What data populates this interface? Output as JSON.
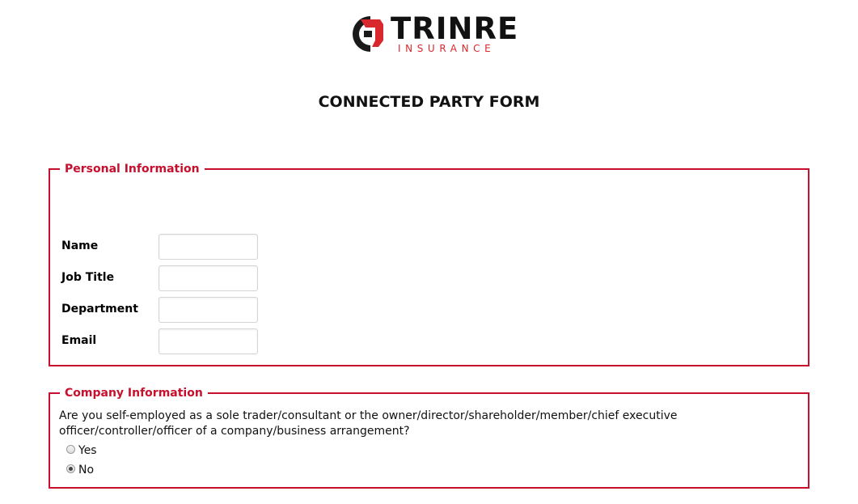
{
  "brand": {
    "name": "TRINRE",
    "tagline": "INSURANCE",
    "accent_color": "#c8102e",
    "logo_icon": "trinre-logo-mark"
  },
  "page": {
    "title": "CONNECTED PARTY FORM"
  },
  "personal_info": {
    "legend": "Personal Information",
    "fields": [
      {
        "label": "Name",
        "value": "",
        "placeholder": ""
      },
      {
        "label": "Job Title",
        "value": "",
        "placeholder": ""
      },
      {
        "label": "Department",
        "value": "",
        "placeholder": ""
      },
      {
        "label": "Email",
        "value": "",
        "placeholder": ""
      }
    ]
  },
  "company_info": {
    "legend": "Company Information",
    "question": "Are you self-employed as a sole trader/consultant or the owner/director/shareholder/member/chief executive officer/controller/officer of a company/business arrangement?",
    "options": [
      {
        "label": "Yes",
        "selected": false
      },
      {
        "label": "No",
        "selected": true
      }
    ]
  }
}
